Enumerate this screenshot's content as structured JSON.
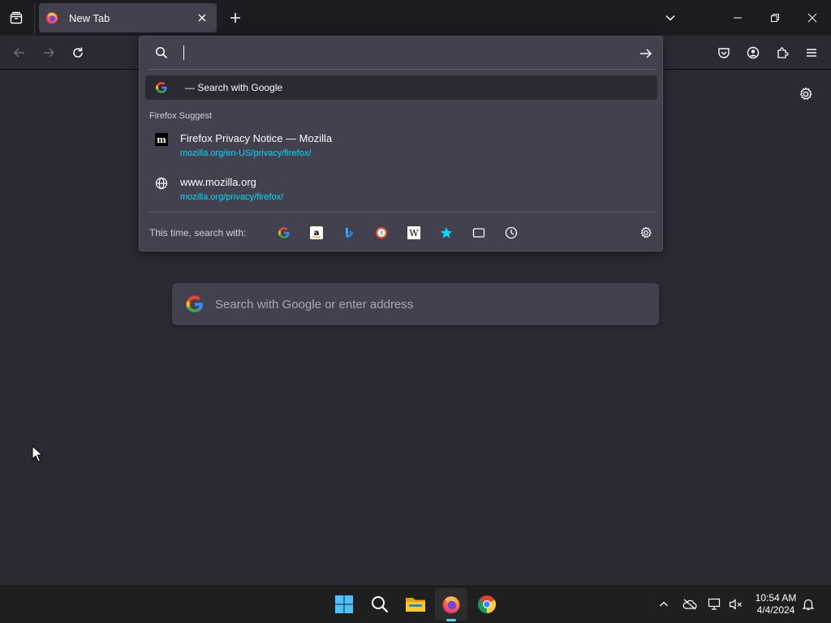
{
  "tabstrip": {
    "tab_title": "New Tab"
  },
  "urlbar": {
    "input_value": "",
    "search_with_text": "— Search with Google",
    "group_label": "Firefox Suggest",
    "results": [
      {
        "title": "Firefox Privacy Notice — Mozilla",
        "url": "mozilla.org/en-US/privacy/firefox/",
        "icon": "mozilla-m-icon"
      },
      {
        "title": "www.mozilla.org",
        "url": "mozilla.org/privacy/firefox/",
        "icon": "globe-icon"
      }
    ],
    "oneoff_label": "This time, search with:",
    "oneoff_engines": [
      "Google",
      "Amazon",
      "Bing",
      "DuckDuckGo",
      "Wikipedia",
      "Bookmarks",
      "Tabs",
      "History"
    ]
  },
  "content": {
    "search_placeholder": "Search with Google or enter address"
  },
  "taskbar": {
    "clock_time": "10:54 AM",
    "clock_date": "4/4/2024"
  },
  "colors": {
    "accent": "#00ddff",
    "page_bg": "#2b2a33",
    "popup_bg": "#42414d",
    "tabstrip_bg": "#1c1b22"
  }
}
